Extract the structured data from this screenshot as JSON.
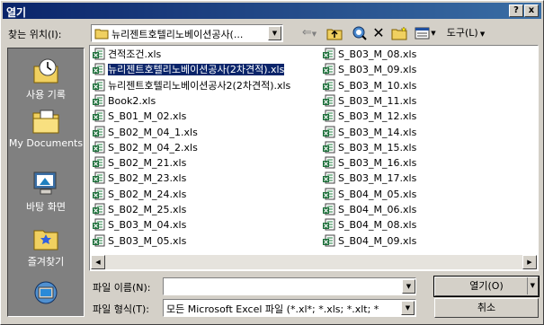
{
  "window": {
    "title": "열기",
    "help_label": "?",
    "close_label": "x"
  },
  "toolbar": {
    "look_in_label": "찾는 위치(I):",
    "look_in_value": "뉴리젠트호텔리노베이션공사(...",
    "tools_label": "도구(L)"
  },
  "places": [
    {
      "label": "사용 기록",
      "icon": "history-icon"
    },
    {
      "label": "My Documents",
      "icon": "my-documents-icon"
    },
    {
      "label": "바탕 화면",
      "icon": "desktop-icon"
    },
    {
      "label": "즐겨찾기",
      "icon": "favorites-icon"
    },
    {
      "label": "",
      "icon": "network-icon"
    }
  ],
  "files": {
    "column1": [
      "견적조건.xls",
      "뉴리젠트호텔리노베이션공사(2차견적).xls",
      "뉴리젠트호텔리노베이션공사2(2차견적).xls",
      "Book2.xls",
      "S_B01_M_02.xls",
      "S_B02_M_04_1.xls",
      "S_B02_M_04_2.xls",
      "S_B02_M_21.xls",
      "S_B02_M_23.xls",
      "S_B02_M_24.xls",
      "S_B02_M_25.xls",
      "S_B03_M_04.xls",
      "S_B03_M_05.xls"
    ],
    "column2": [
      "S_B03_M_08.xls",
      "S_B03_M_09.xls",
      "S_B03_M_10.xls",
      "S_B03_M_11.xls",
      "S_B03_M_12.xls",
      "S_B03_M_14.xls",
      "S_B03_M_15.xls",
      "S_B03_M_16.xls",
      "S_B03_M_17.xls",
      "S_B04_M_05.xls",
      "S_B04_M_06.xls",
      "S_B04_M_08.xls",
      "S_B04_M_09.xls"
    ],
    "selected": "뉴리젠트호텔리노베이션공사(2차견적).xls"
  },
  "filename": {
    "label": "파일 이름(N):",
    "value": ""
  },
  "filetype": {
    "label": "파일 형식(T):",
    "value": "모든 Microsoft Excel 파일 (*.xl*; *.xls; *.xlt; *"
  },
  "buttons": {
    "open": "열기(O)",
    "cancel": "취소"
  },
  "colors": {
    "title_start": "#0a246a",
    "title_end": "#3a6ea5",
    "selection": "#0a246a",
    "face": "#d4d0c8"
  }
}
